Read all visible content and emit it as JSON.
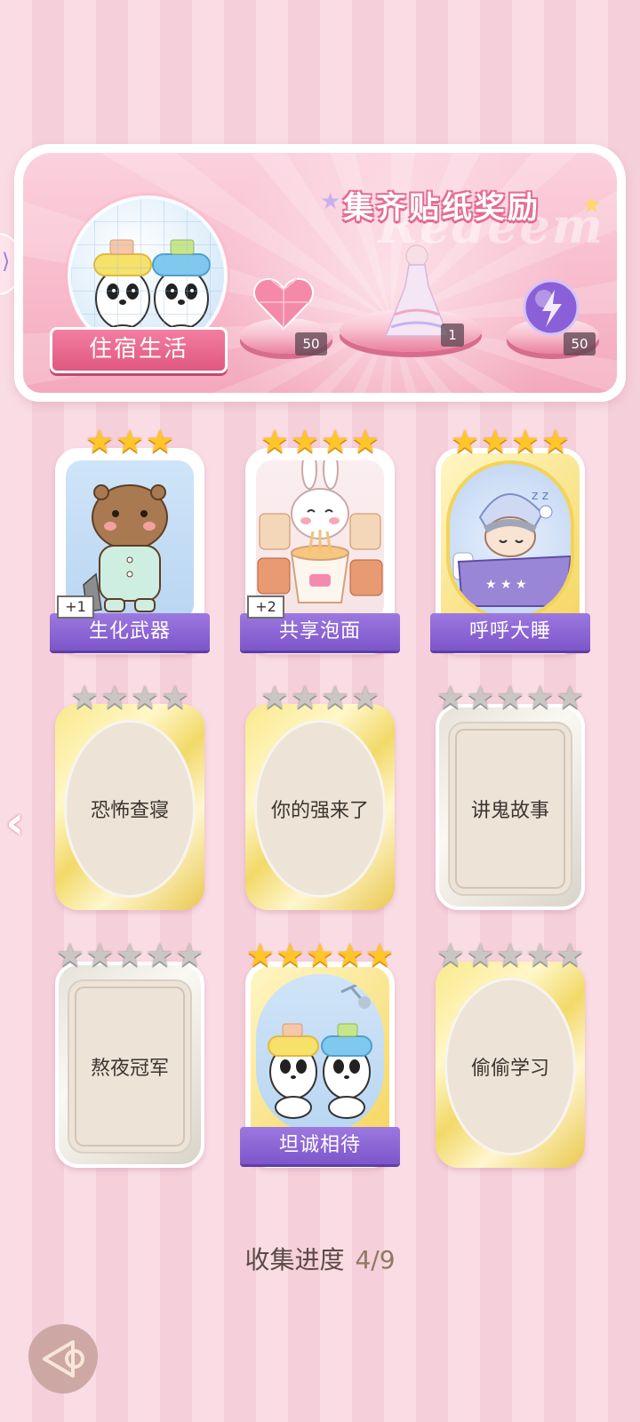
{
  "banner": {
    "title": "集齐贴纸奖励",
    "watermark": "Redeem",
    "album_label": "住宿生活",
    "rewards": [
      {
        "icon": "heart-gem-icon",
        "count": "50"
      },
      {
        "icon": "dress-icon",
        "count": "1"
      },
      {
        "icon": "energy-orb-icon",
        "count": "50"
      }
    ]
  },
  "cards": [
    {
      "name": "生化武器",
      "stars": 3,
      "max_stars": 3,
      "collected": true,
      "duplicates": "+1"
    },
    {
      "name": "共享泡面",
      "stars": 4,
      "max_stars": 4,
      "collected": true,
      "duplicates": "+2"
    },
    {
      "name": "呼呼大睡",
      "stars": 4,
      "max_stars": 4,
      "collected": true,
      "duplicates": ""
    },
    {
      "name": "恐怖查寝",
      "stars": 0,
      "max_stars": 4,
      "collected": false
    },
    {
      "name": "你的强来了",
      "stars": 0,
      "max_stars": 4,
      "collected": false
    },
    {
      "name": "讲鬼故事",
      "stars": 0,
      "max_stars": 5,
      "collected": false
    },
    {
      "name": "熬夜冠军",
      "stars": 0,
      "max_stars": 5,
      "collected": false
    },
    {
      "name": "坦诚相待",
      "stars": 5,
      "max_stars": 5,
      "collected": true,
      "duplicates": ""
    },
    {
      "name": "偷偷学习",
      "stars": 0,
      "max_stars": 5,
      "collected": false
    }
  ],
  "progress": {
    "label": "收集进度",
    "value": "4/9"
  },
  "colors": {
    "accent": "#e56d93",
    "ribbon": "#8a64d4",
    "gold_star": "#ffc629",
    "grey_star": "#c9c6c4"
  }
}
